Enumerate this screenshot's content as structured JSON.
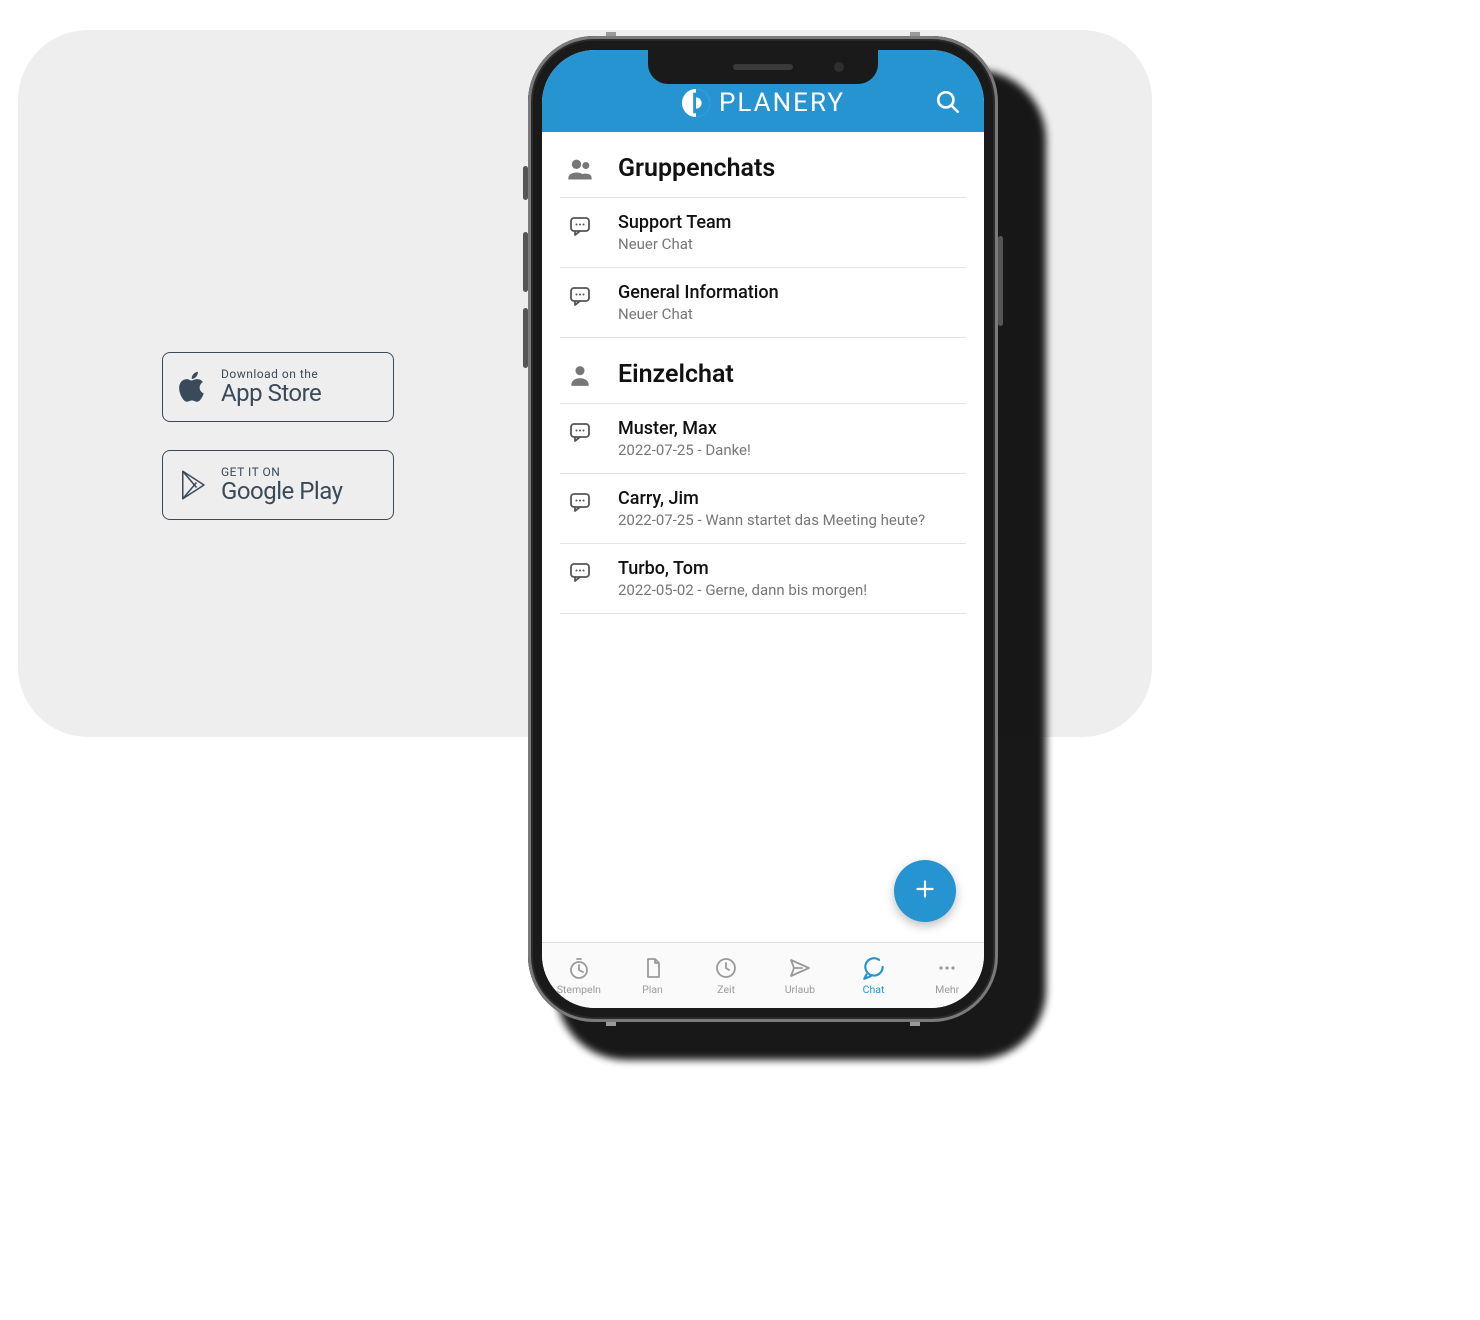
{
  "badges": {
    "appstore_top": "Download on the",
    "appstore_bottom": "App Store",
    "play_top": "GET IT ON",
    "play_bottom": "Google Play"
  },
  "app": {
    "title": "PLANERY"
  },
  "sections": {
    "group_title": "Gruppenchats",
    "single_title": "Einzelchat"
  },
  "group_chats": [
    {
      "title": "Support Team",
      "subtitle": "Neuer Chat"
    },
    {
      "title": "General Information",
      "subtitle": "Neuer Chat"
    }
  ],
  "single_chats": [
    {
      "title": "Muster, Max",
      "subtitle": "2022-07-25 - Danke!"
    },
    {
      "title": "Carry, Jim",
      "subtitle": "2022-07-25 - Wann startet das Meeting heute?"
    },
    {
      "title": "Turbo, Tom",
      "subtitle": "2022-05-02 - Gerne, dann bis morgen!"
    }
  ],
  "tabs": [
    {
      "label": "Stempeln"
    },
    {
      "label": "Plan"
    },
    {
      "label": "Zeit"
    },
    {
      "label": "Urlaub"
    },
    {
      "label": "Chat"
    },
    {
      "label": "Mehr"
    }
  ],
  "active_tab_index": 4,
  "colors": {
    "accent": "#2794d2",
    "card_bg": "#eeeeee"
  }
}
